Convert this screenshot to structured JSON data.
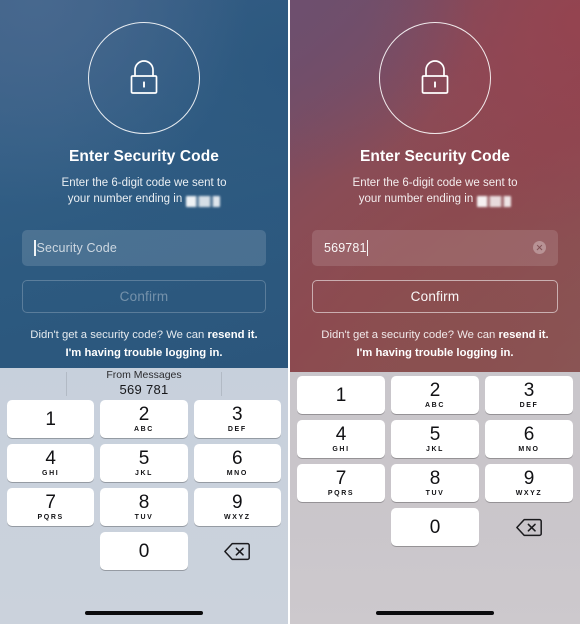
{
  "panels": [
    {
      "id": "left",
      "theme_color": "#3f6189",
      "lock_icon": "lock-icon",
      "title": "Enter Security Code",
      "subtitle_line1": "Enter the 6-digit code we sent to",
      "subtitle_line2": "your number ending in",
      "phone_suffix_redacted": true,
      "field": {
        "placeholder": "Security Code",
        "value": "",
        "has_caret": true,
        "has_clear_button": false
      },
      "confirm_label": "Confirm",
      "confirm_enabled": false,
      "links": {
        "line1_prefix": "Didn't get a security code? We can ",
        "line1_link": "resend it.",
        "line2": "I'm having trouble logging in."
      },
      "keyboard": {
        "autofill_visible": true,
        "autofill_source": "From Messages",
        "autofill_code": "569 781",
        "rows": [
          [
            {
              "digit": "1",
              "letters": ""
            },
            {
              "digit": "2",
              "letters": "ABC"
            },
            {
              "digit": "3",
              "letters": "DEF"
            }
          ],
          [
            {
              "digit": "4",
              "letters": "GHI"
            },
            {
              "digit": "5",
              "letters": "JKL"
            },
            {
              "digit": "6",
              "letters": "MNO"
            }
          ],
          [
            {
              "digit": "7",
              "letters": "PQRS"
            },
            {
              "digit": "8",
              "letters": "TUV"
            },
            {
              "digit": "9",
              "letters": "WXYZ"
            }
          ]
        ],
        "zero_key": {
          "digit": "0",
          "letters": ""
        },
        "delete_icon": "backspace-delete-icon"
      }
    },
    {
      "id": "right",
      "theme_color": "#8e4550",
      "lock_icon": "lock-icon",
      "title": "Enter Security Code",
      "subtitle_line1": "Enter the 6-digit code we sent to",
      "subtitle_line2": "your number ending in",
      "phone_suffix_redacted": true,
      "field": {
        "placeholder": "Security Code",
        "value": "569781",
        "has_caret": true,
        "has_clear_button": true
      },
      "confirm_label": "Confirm",
      "confirm_enabled": true,
      "links": {
        "line1_prefix": "Didn't get a security code? We can ",
        "line1_link": "resend it.",
        "line2": "I'm having trouble logging in."
      },
      "keyboard": {
        "autofill_visible": false,
        "autofill_source": "",
        "autofill_code": "",
        "rows": [
          [
            {
              "digit": "1",
              "letters": ""
            },
            {
              "digit": "2",
              "letters": "ABC"
            },
            {
              "digit": "3",
              "letters": "DEF"
            }
          ],
          [
            {
              "digit": "4",
              "letters": "GHI"
            },
            {
              "digit": "5",
              "letters": "JKL"
            },
            {
              "digit": "6",
              "letters": "MNO"
            }
          ],
          [
            {
              "digit": "7",
              "letters": "PQRS"
            },
            {
              "digit": "8",
              "letters": "TUV"
            },
            {
              "digit": "9",
              "letters": "WXYZ"
            }
          ]
        ],
        "zero_key": {
          "digit": "0",
          "letters": ""
        },
        "delete_icon": "backspace-delete-icon"
      }
    }
  ]
}
